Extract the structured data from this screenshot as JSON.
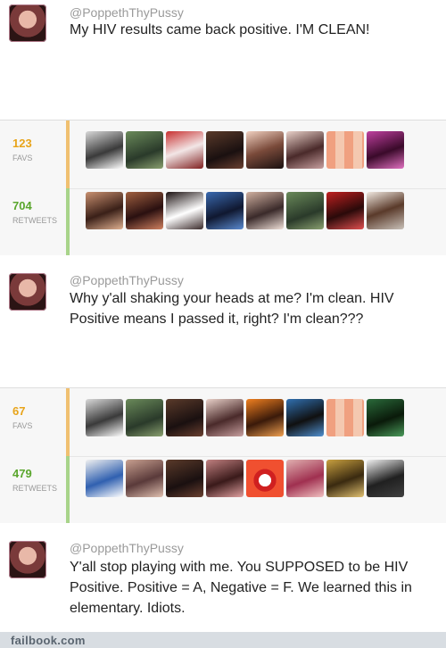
{
  "tweets": [
    {
      "handle": "@PoppethThyPussy",
      "text": "My HIV results came back positive. I'M CLEAN!",
      "favs_count": "123",
      "favs_label": "FAVS",
      "retweets_count": "704",
      "retweets_label": "RETWEETS"
    },
    {
      "handle": "@PoppethThyPussy",
      "text": "Why y'all shaking your heads at me? I'm clean. HIV Positive means I passed it, right? I'm clean???",
      "favs_count": "67",
      "favs_label": "FAVS",
      "retweets_count": "479",
      "retweets_label": "RETWEETS"
    },
    {
      "handle": "@PoppethThyPussy",
      "text": "Y'all stop playing with me. You SUPPOSED to be HIV Positive. Positive = A, Negative = F. We learned this in elementary. Idiots."
    }
  ],
  "footer": {
    "site": "failbook.com"
  },
  "colors": {
    "favs": "#e8a41a",
    "retweets": "#5aa62d",
    "handle": "#9a9a9a",
    "stats_bg": "#f7f7f7"
  }
}
